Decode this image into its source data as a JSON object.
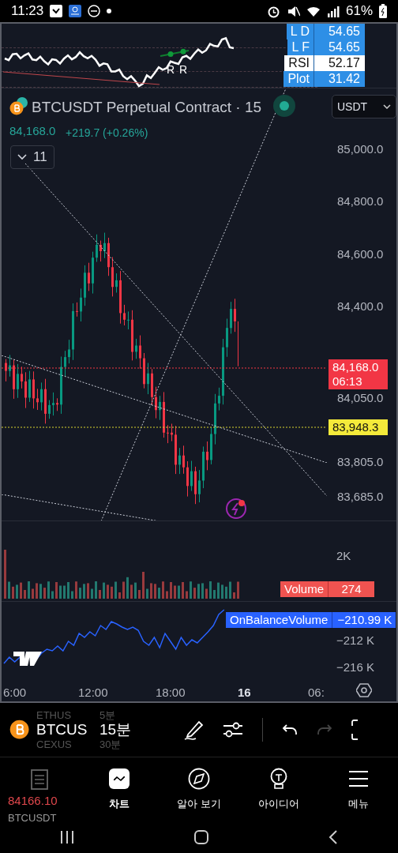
{
  "status_bar": {
    "time": "11:23",
    "battery": "61%"
  },
  "rsi_panel": {
    "markers": [
      "R",
      "R"
    ],
    "legend": [
      {
        "label": "L D",
        "value": "54.65",
        "highlighted": false
      },
      {
        "label": "L F",
        "value": "54.65",
        "highlighted": false
      },
      {
        "label": "RSI",
        "value": "52.17",
        "highlighted": true
      },
      {
        "label": "Plot",
        "value": "31.42",
        "highlighted": false
      }
    ]
  },
  "header": {
    "title": "BTCUSDT Perpetual Contract · 15",
    "price": "84,168.0",
    "change": "+219.7 (+0.26%)",
    "currency": "USDT",
    "collapse_count": "11"
  },
  "price_axis": [
    "85,000.0",
    "84,800.0",
    "84,600.0",
    "84,400.0",
    "84,050.0",
    "83,805.0",
    "83,685.0"
  ],
  "last_price": {
    "price": "84,168.0",
    "countdown": "06:13"
  },
  "marked_price": "83,948.3",
  "volume": {
    "axis": "2K",
    "label": "Volume",
    "value": "274"
  },
  "obv": {
    "label": "OnBalanceVolume",
    "value": "−210.99 K",
    "axis": [
      "−212 K",
      "−216 K"
    ]
  },
  "time_axis": [
    {
      "label": "6:00",
      "bold": false
    },
    {
      "label": "12:00",
      "bold": false
    },
    {
      "label": "18:00",
      "bold": false
    },
    {
      "label": "16",
      "bold": true
    },
    {
      "label": "06:",
      "bold": false
    }
  ],
  "toolbar": {
    "symbols": [
      {
        "symbol": "ETHUS",
        "interval": "5분",
        "selected": false
      },
      {
        "symbol": "BTCUS",
        "interval": "15분",
        "selected": true
      },
      {
        "symbol": "CEXUS",
        "interval": "30분",
        "selected": false
      }
    ],
    "redo_disabled": true
  },
  "overlay": {
    "price": "84166.10",
    "symbol": "BTCUSDT"
  },
  "nav": [
    {
      "kind": "list",
      "selected": false
    },
    {
      "kind": "chart",
      "label": "차트",
      "selected": true
    },
    {
      "kind": "compass",
      "label": "알아 보기",
      "selected": false
    },
    {
      "kind": "bulb",
      "label": "아이디어",
      "selected": false
    },
    {
      "kind": "menu",
      "label": "메뉴",
      "selected": false
    }
  ]
}
